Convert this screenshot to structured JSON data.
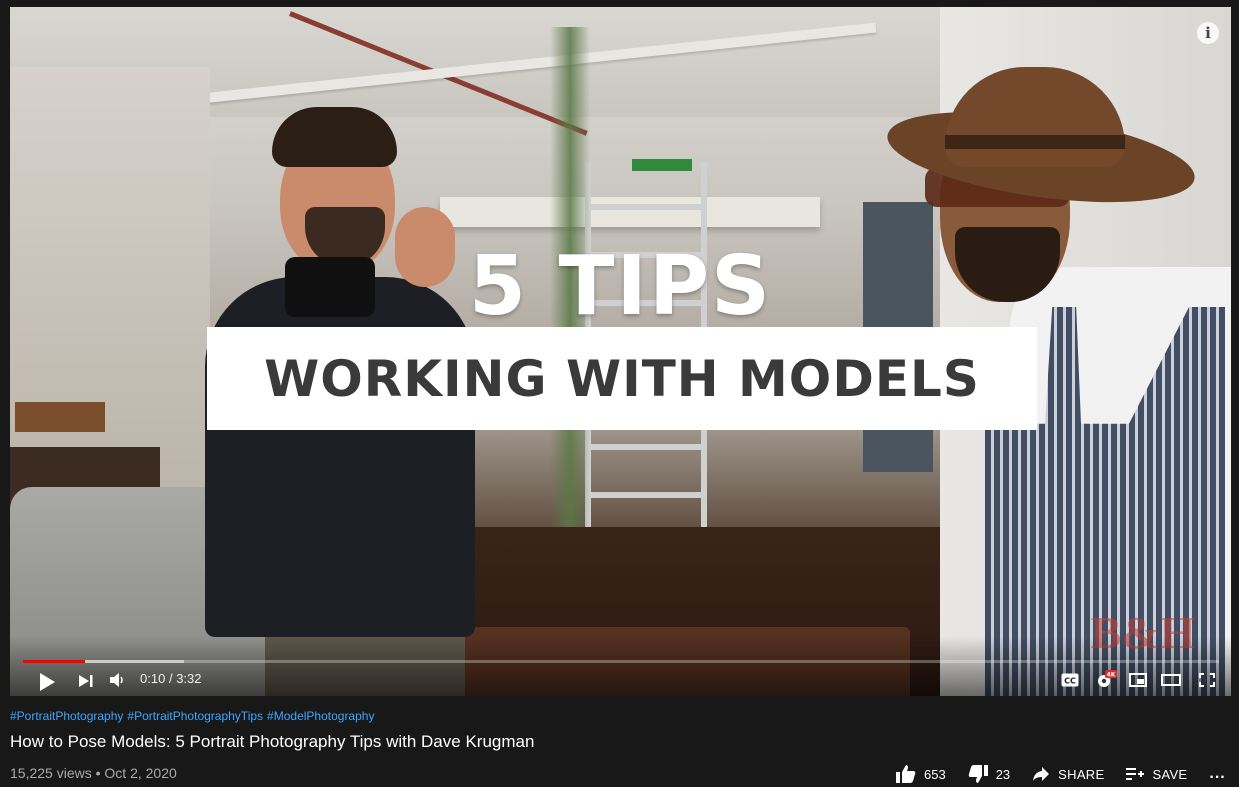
{
  "video": {
    "overlay_title": "5 TIPS",
    "overlay_subtitle": "WORKING WITH MODELS",
    "watermark": "B&H",
    "info_label": "i",
    "progress_percent": 5.2,
    "buffer_percent": 13.5,
    "time_current": "0:10",
    "time_separator": "/",
    "time_total": "3:32"
  },
  "info": {
    "hashtags": [
      "#PortraitPhotography",
      "#PortraitPhotographyTips",
      "#ModelPhotography"
    ],
    "title": "How to Pose Models: 5 Portrait Photography Tips with Dave Krugman",
    "views": "15,225 views",
    "separator": "•",
    "date": "Oct 2, 2020"
  },
  "actions": {
    "like_count": "653",
    "dislike_count": "23",
    "share_label": "SHARE",
    "save_label": "SAVE",
    "more_label": "..."
  },
  "colors": {
    "progress": "#ff0000",
    "hashtag": "#3ea6ff",
    "background": "#181818"
  }
}
